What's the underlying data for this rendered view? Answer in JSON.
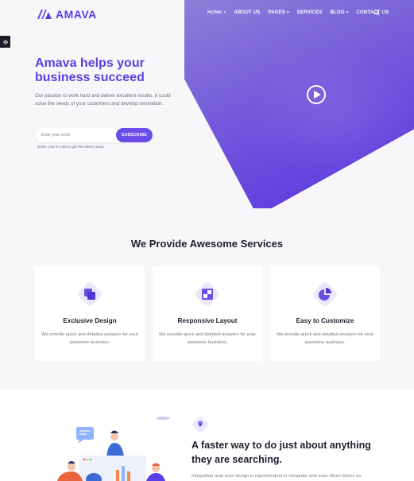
{
  "brand": {
    "name": "AMAVA",
    "accent": "#5b3fe4"
  },
  "nav": {
    "items": [
      {
        "label": "HOME",
        "dropdown": true
      },
      {
        "label": "ABOUT US",
        "dropdown": false
      },
      {
        "label": "PAGES",
        "dropdown": true
      },
      {
        "label": "SERVICES",
        "dropdown": false
      },
      {
        "label": "BLOG",
        "dropdown": true
      },
      {
        "label": "CONTACT US",
        "dropdown": false
      }
    ],
    "search_icon": "search-icon"
  },
  "hero": {
    "title": "Amava helps your business succeed",
    "subtitle": "Our passion to work hard and deliver excellent results. It could solve the needs of your customers and develop innovation.",
    "email_placeholder": "Enter your email",
    "subscribe_label": "SUBSCRIBE",
    "note": "Enter your e-mail to get the latest news.",
    "play_icon": "play-icon"
  },
  "services": {
    "title": "We Provide Awesome Services",
    "cards": [
      {
        "title": "Exclusive Design",
        "text": "We provide quick and detailed answers for your awesome business.",
        "icon": "layers-icon"
      },
      {
        "title": "Responsive Layout",
        "text": "We provide quick and detailed answers for your awesome business.",
        "icon": "grid-icon"
      },
      {
        "title": "Easy to Customize",
        "text": "We provide quick and detailed answers for your awesome business.",
        "icon": "pie-chart-icon"
      }
    ]
  },
  "feature": {
    "title": "A faster way to do just about anything they are searching.",
    "text": "Integration aute irure design in reprehenderit in voluptate velit esse cillum dolore eu",
    "icon": "diamond-icon"
  }
}
